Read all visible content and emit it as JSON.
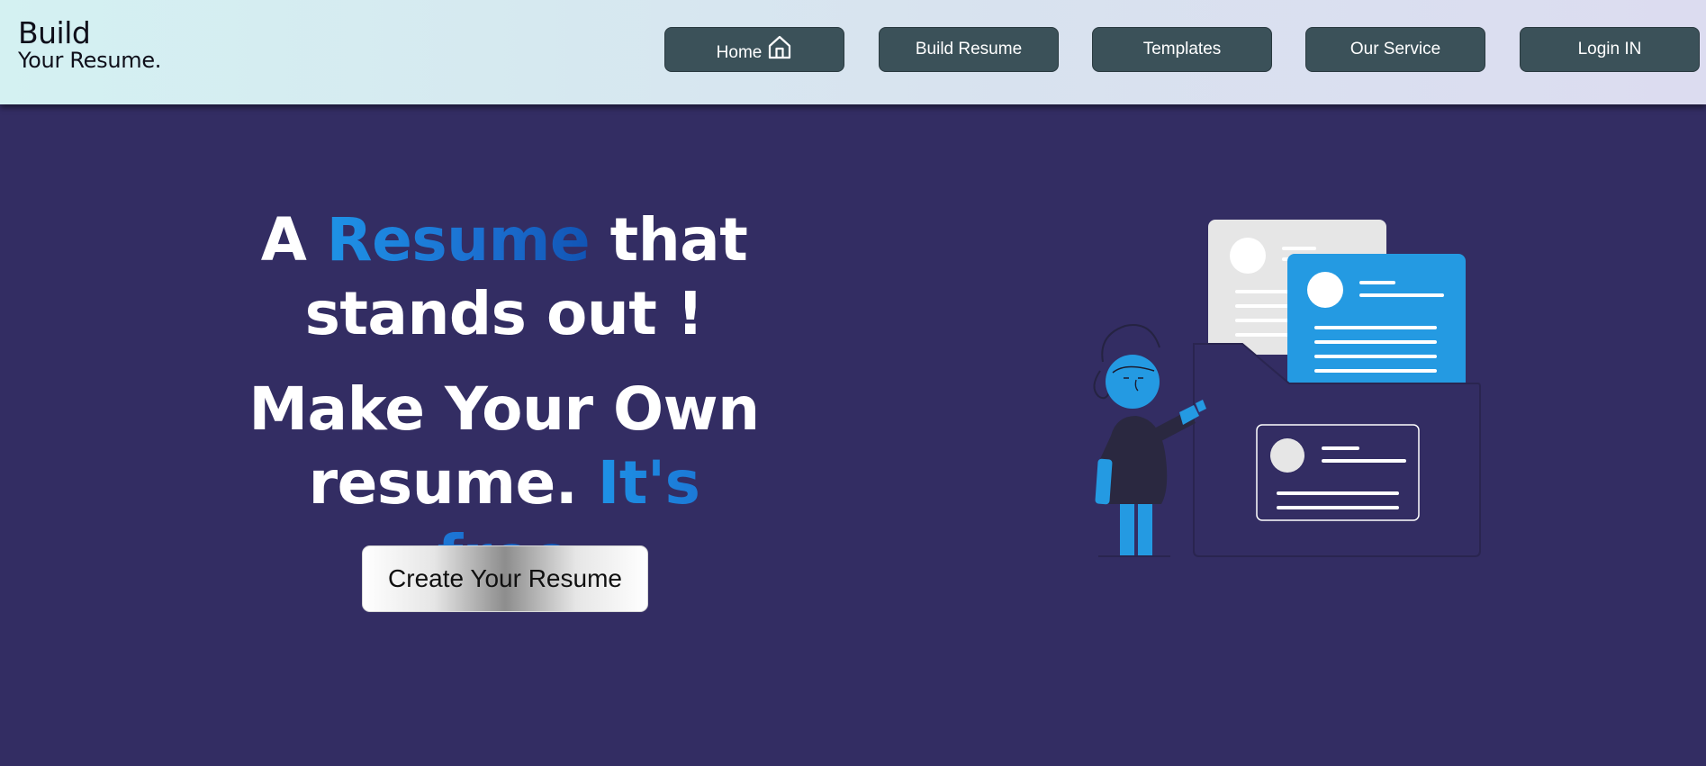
{
  "logo": {
    "line1": "Build",
    "line2": "Your Resume."
  },
  "nav": {
    "home": "Home",
    "build_resume": "Build Resume",
    "templates": "Templates",
    "our_service": "Our Service",
    "login": "Login IN"
  },
  "hero": {
    "line1_pre": "A ",
    "line1_accent": "Resume",
    "line1_post": " that",
    "line2": "stands out !",
    "line3": "Make Your Own",
    "line4_pre": "resume. ",
    "line4_accent": "It's free"
  },
  "cta": {
    "label": "Create Your Resume"
  },
  "icons": [
    "home-icon"
  ],
  "colors": {
    "background": "#332d63",
    "nav_button": "#3b5159",
    "accent_blue": "#1e92e6",
    "card_blue": "#249ae2",
    "card_gray": "#e6e6e6"
  }
}
